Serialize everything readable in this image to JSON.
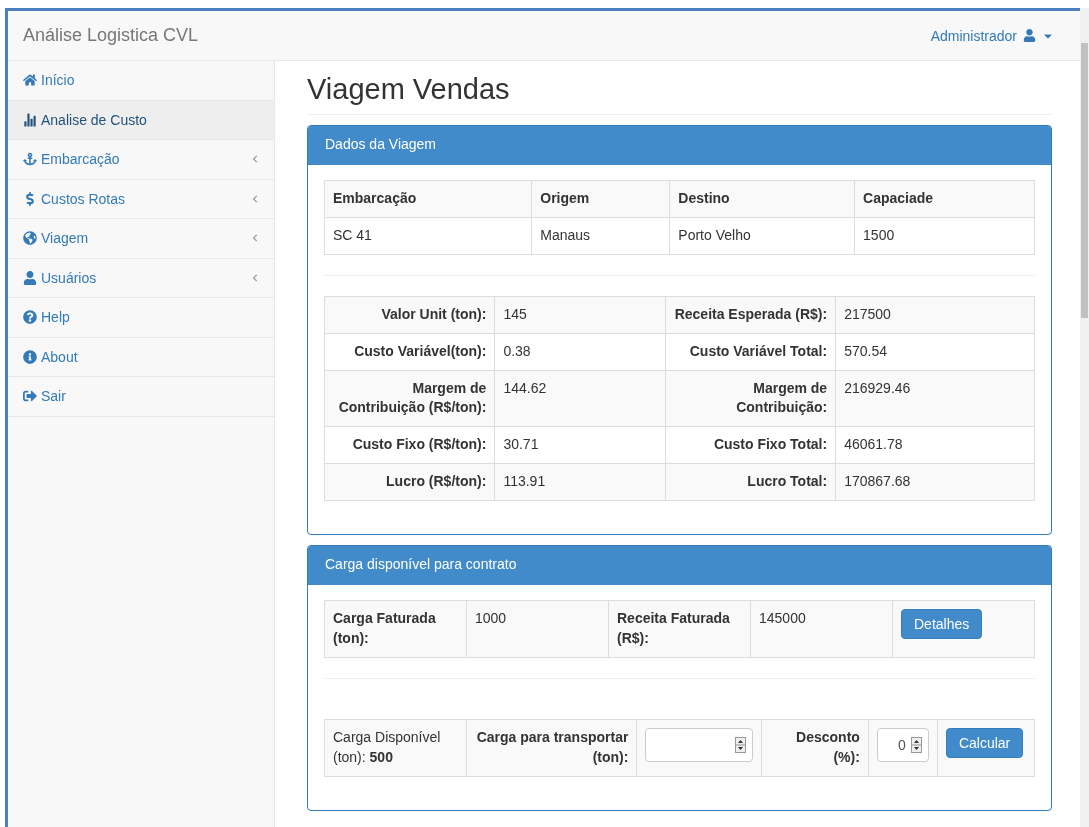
{
  "navbar": {
    "brand": "Análise Logistica CVL",
    "user": "Administrador"
  },
  "sidebar": {
    "items": [
      {
        "label": "Início",
        "selected": false,
        "has_submenu": false
      },
      {
        "label": "Analise de Custo",
        "selected": true,
        "has_submenu": false
      },
      {
        "label": "Embarcação",
        "selected": false,
        "has_submenu": true
      },
      {
        "label": "Custos Rotas",
        "selected": false,
        "has_submenu": true
      },
      {
        "label": "Viagem",
        "selected": false,
        "has_submenu": true
      },
      {
        "label": "Usuários",
        "selected": false,
        "has_submenu": true
      },
      {
        "label": "Help",
        "selected": false,
        "has_submenu": false
      },
      {
        "label": "About",
        "selected": false,
        "has_submenu": false
      },
      {
        "label": "Sair",
        "selected": false,
        "has_submenu": false
      }
    ]
  },
  "page_title": "Viagem Vendas",
  "trip_panel": {
    "title": "Dados da Viagem",
    "table": {
      "columns": [
        "Embarcação",
        "Origem",
        "Destino",
        "Capaciade"
      ],
      "rows": [
        [
          "SC 41",
          "Manaus",
          "Porto Velho",
          "1500"
        ]
      ]
    },
    "summary_rows": [
      [
        "Valor Unit (ton):",
        "145",
        "Receita Esperada (R$):",
        "217500"
      ],
      [
        "Custo Variável(ton):",
        "0.38",
        "Custo Variável Total:",
        "570.54"
      ],
      [
        "Margem de Contribuição (R$/ton):",
        "144.62",
        "Margem de Contribuição:",
        "216929.46"
      ],
      [
        "Custo Fixo (R$/ton):",
        "30.71",
        "Custo Fixo Total:",
        "46061.78"
      ],
      [
        "Lucro (R$/ton):",
        "113.91",
        "Lucro Total:",
        "170867.68"
      ]
    ]
  },
  "cargo_panel": {
    "title": "Carga disponível para contrato",
    "invoiced": {
      "cargo_label": "Carga Faturada (ton):",
      "cargo_value": "1000",
      "revenue_label": "Receita Faturada (R$):",
      "revenue_value": "145000",
      "button": "Detalhes"
    },
    "calculator": {
      "available": "Carga Disponível (ton): **500**",
      "transport_label": "Carga para transportar (ton):",
      "discount_label": "Desconto (%):",
      "discount_value": "0",
      "button": "Calcular"
    }
  }
}
